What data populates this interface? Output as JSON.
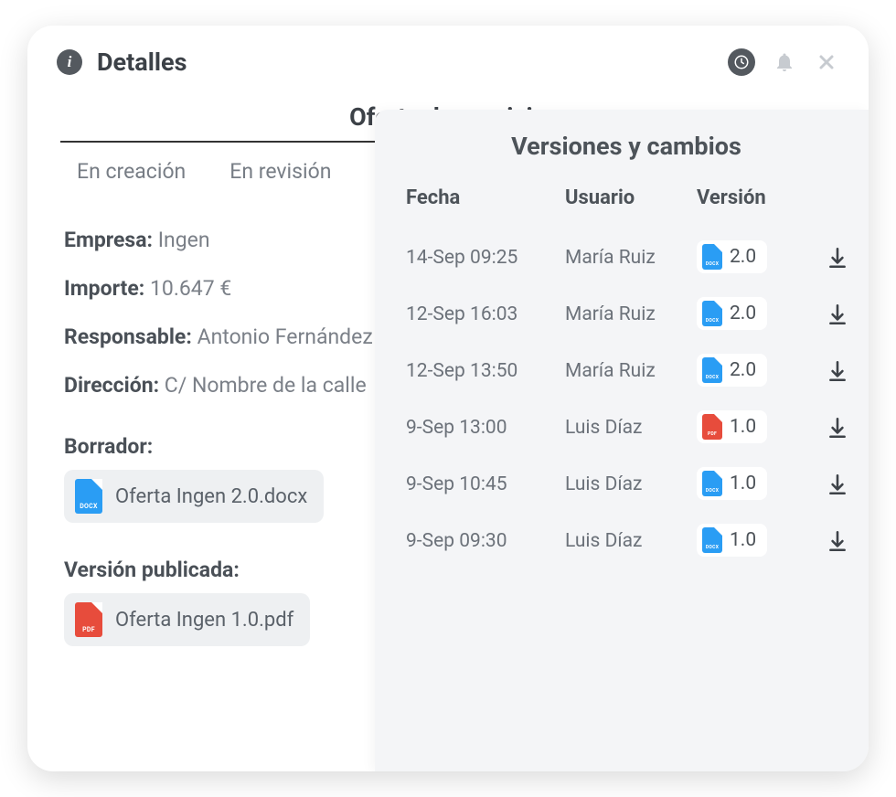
{
  "header": {
    "title": "Detalles"
  },
  "subtitle": "Oferta de servicio",
  "tabs": [
    {
      "label": "En creación"
    },
    {
      "label": "En revisión"
    }
  ],
  "details": {
    "empresa_label": "Empresa:",
    "empresa_value": "Ingen",
    "importe_label": "Importe:",
    "importe_value": "10.647 €",
    "responsable_label": "Responsable:",
    "responsable_value": "Antonio Fernández",
    "direccion_label": "Dirección:",
    "direccion_value": "C/ Nombre de la calle"
  },
  "borrador": {
    "label": "Borrador:",
    "file_name": "Oferta Ingen 2.0.docx",
    "file_type": "docx"
  },
  "publicada": {
    "label": "Versión publicada:",
    "file_name": "Oferta Ingen 1.0.pdf",
    "file_type": "pdf"
  },
  "panel": {
    "title": "Versiones y cambios",
    "columns": {
      "fecha": "Fecha",
      "usuario": "Usuario",
      "version": "Versión"
    },
    "rows": [
      {
        "fecha": "14-Sep 09:25",
        "usuario": "María Ruiz",
        "version": "2.0",
        "type": "docx"
      },
      {
        "fecha": "12-Sep 16:03",
        "usuario": "María Ruiz",
        "version": "2.0",
        "type": "docx"
      },
      {
        "fecha": "12-Sep 13:50",
        "usuario": "María Ruiz",
        "version": "2.0",
        "type": "docx"
      },
      {
        "fecha": "9-Sep 13:00",
        "usuario": "Luis Díaz",
        "version": "1.0",
        "type": "pdf"
      },
      {
        "fecha": "9-Sep 10:45",
        "usuario": "Luis Díaz",
        "version": "1.0",
        "type": "docx"
      },
      {
        "fecha": "9-Sep 09:30",
        "usuario": "Luis Díaz",
        "version": "1.0",
        "type": "docx"
      }
    ]
  }
}
